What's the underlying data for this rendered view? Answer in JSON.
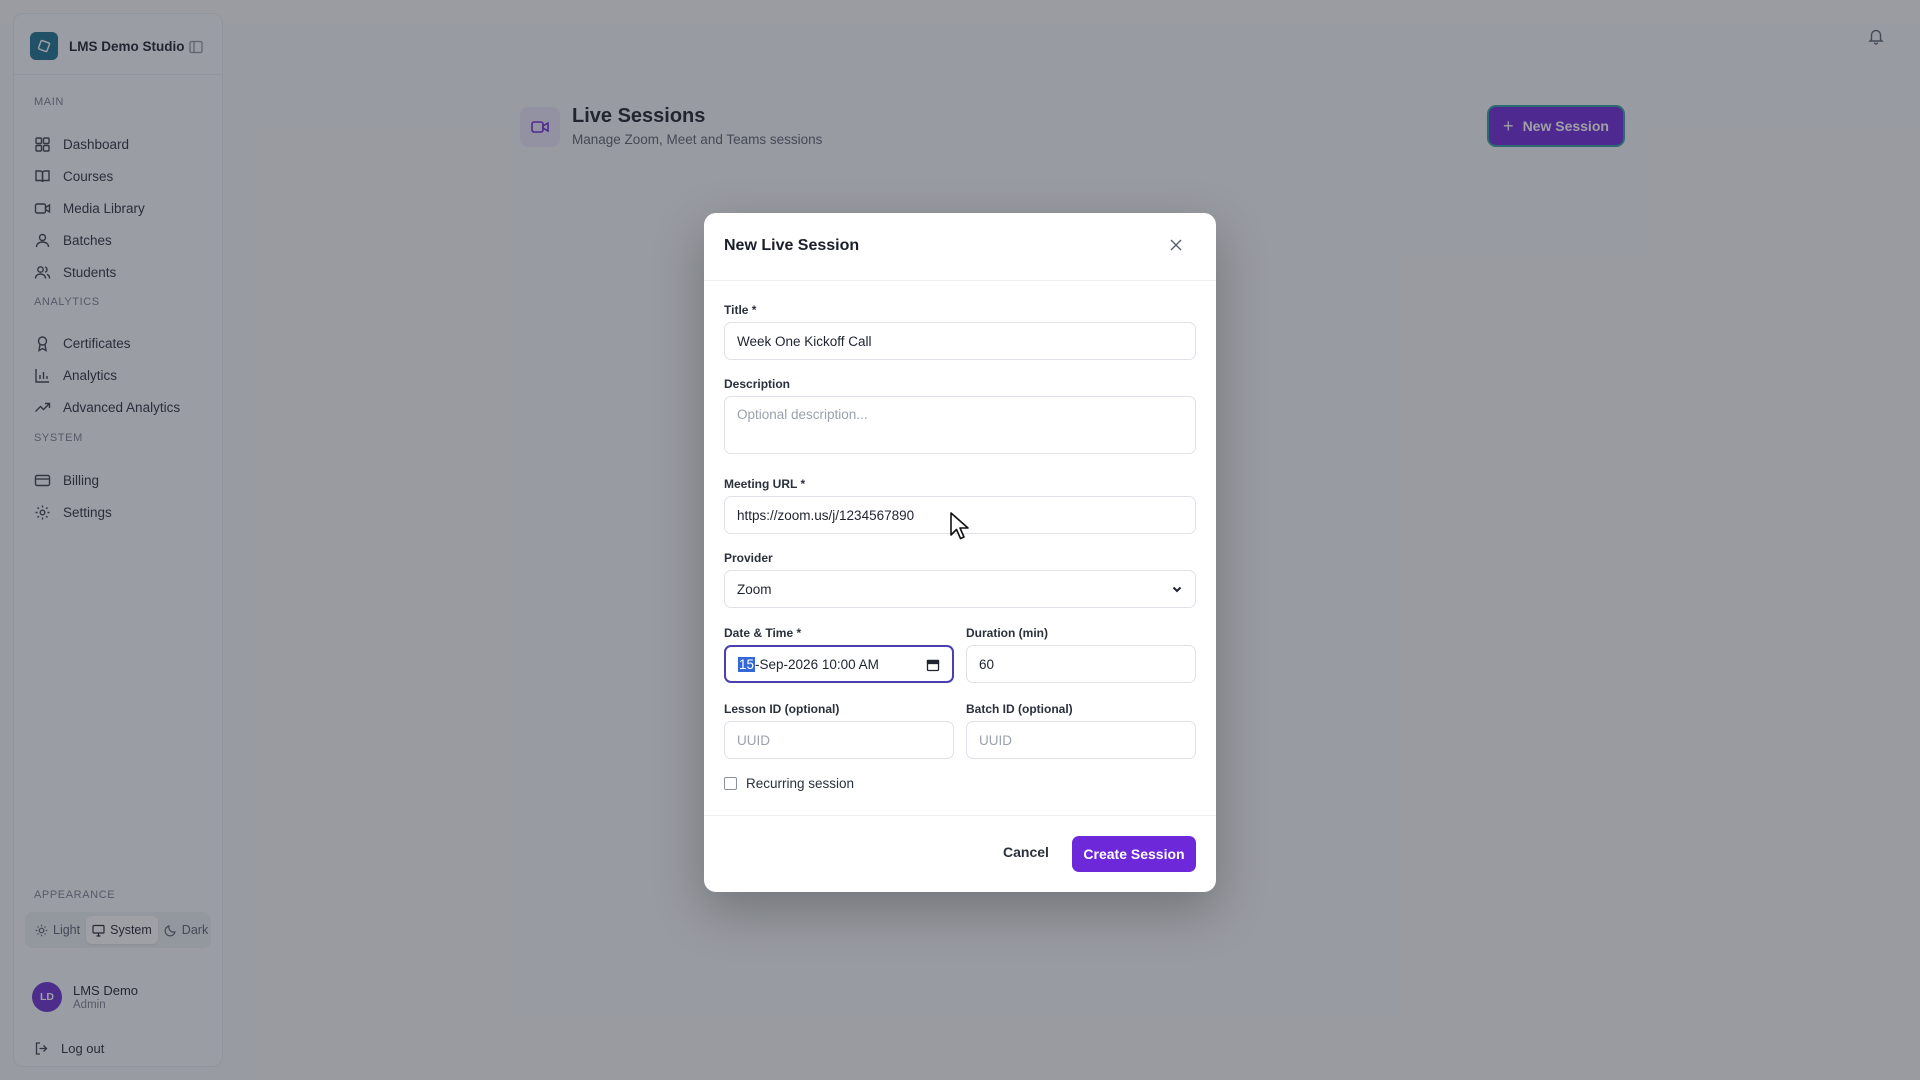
{
  "sidebar": {
    "brand": "LMS Demo Studio",
    "sections": [
      {
        "label": "MAIN",
        "items": [
          {
            "label": "Dashboard",
            "icon": "dashboard-icon"
          },
          {
            "label": "Courses",
            "icon": "book-icon"
          },
          {
            "label": "Media Library",
            "icon": "video-icon"
          },
          {
            "label": "Batches",
            "icon": "user-icon"
          },
          {
            "label": "Students",
            "icon": "users-icon"
          }
        ]
      },
      {
        "label": "ANALYTICS",
        "items": [
          {
            "label": "Certificates",
            "icon": "award-icon"
          },
          {
            "label": "Analytics",
            "icon": "bar-chart-icon"
          },
          {
            "label": "Advanced Analytics",
            "icon": "trending-up-icon"
          }
        ]
      },
      {
        "label": "SYSTEM",
        "items": [
          {
            "label": "Billing",
            "icon": "credit-card-icon"
          },
          {
            "label": "Settings",
            "icon": "gear-icon"
          }
        ]
      }
    ],
    "appearance": {
      "label": "APPEARANCE",
      "options": [
        "Light",
        "System",
        "Dark"
      ],
      "selected": "System"
    },
    "user": {
      "initials": "LD",
      "name": "LMS Demo",
      "role": "Admin"
    },
    "logout": "Log out"
  },
  "page": {
    "title": "Live Sessions",
    "subtitle": "Manage Zoom, Meet and Teams sessions",
    "new_button": "New Session"
  },
  "modal": {
    "title": "New Live Session",
    "fields": {
      "title": {
        "label": "Title *",
        "value": "Week One Kickoff Call"
      },
      "description": {
        "label": "Description",
        "placeholder": "Optional description..."
      },
      "meeting_url": {
        "label": "Meeting URL *",
        "value": "https://zoom.us/j/1234567890"
      },
      "provider": {
        "label": "Provider",
        "value": "Zoom"
      },
      "datetime": {
        "label": "Date & Time *",
        "day": "15",
        "rest": "-Sep-2026 10:00 AM"
      },
      "duration": {
        "label": "Duration (min)",
        "value": "60"
      },
      "lesson_id": {
        "label": "Lesson ID (optional)",
        "placeholder": "UUID"
      },
      "batch_id": {
        "label": "Batch ID (optional)",
        "placeholder": "UUID"
      }
    },
    "recurring": {
      "label": "Recurring session",
      "checked": false
    },
    "cancel": "Cancel",
    "create": "Create Session"
  },
  "colors": {
    "accent": "#6d28d9",
    "brand": "#1c6f8c",
    "focus": "#4b3fb0"
  }
}
